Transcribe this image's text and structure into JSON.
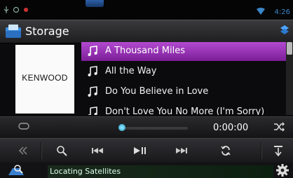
{
  "statusbar": {
    "clock": "4:26"
  },
  "header": {
    "source_title": "Storage"
  },
  "artwork": {
    "brand_text": "KENWOOD"
  },
  "tracks": [
    {
      "title": "A Thousand Miles",
      "selected": true
    },
    {
      "title": "All the Way",
      "selected": false
    },
    {
      "title": "Do You Believe in Love",
      "selected": false
    },
    {
      "title": "Don't Love You No More (I'm Sorry)",
      "selected": false
    }
  ],
  "playback": {
    "elapsed": "0:00:00",
    "progress_fraction": 0.02
  },
  "status": {
    "message": "Locating Satellites"
  },
  "colors": {
    "accent": "#9b32b8",
    "clock": "#3a86c8",
    "progress_knob": "#29c"
  }
}
